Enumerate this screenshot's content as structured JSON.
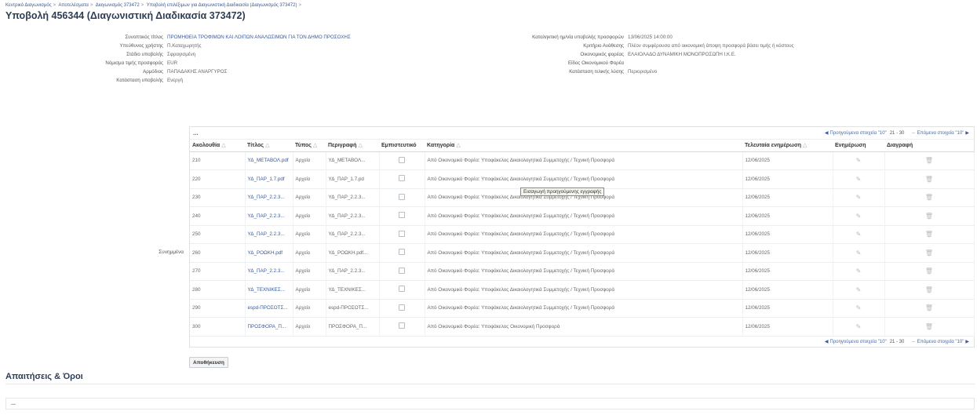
{
  "breadcrumb": [
    "Κεντρικό Διαγωνισμός",
    "Αποτελέσματα",
    "Διαγωνισμός 373472",
    "Υποβολή επιλέξιμων για Διαγωνιστική Διαδικασία (Διαγωνισμός 373472)"
  ],
  "page_title": "Υποβολή 456344 (Διαγωνιστική Διαδικασία 373472)",
  "left_fields": [
    {
      "label": "Συνοπτικός τίτλος",
      "value": "ΠΡΟΜΗΘΕΙΑ ΤΡΟΦΙΜΩΝ ΚΑΙ ΛΟΙΠΩΝ ΑΝΑΛΩΣΙΜΩΝ ΓΙΑ ΤΟΝ ΔΗΜΟ ΠΡΟΣΟΧΗΣ",
      "link": true
    },
    {
      "label": "Υπεύθυνος χρήστης",
      "value": "Π.Καταχωρητής",
      "link": false
    },
    {
      "label": "Στάδιο υποβολής",
      "value": "Σφραγισμένη",
      "link": false
    },
    {
      "label": "Νόμισμα τιμής προσφοράς",
      "value": "EUR",
      "link": false
    },
    {
      "label": "Αρμόδιος",
      "value": "ΠΑΠΑΔΑΚΗΣ ΑΝΑΡΓΥΡΟΣ",
      "link": false
    },
    {
      "label": "Κατάσταση υποβολής",
      "value": "Ενεργή",
      "link": false
    }
  ],
  "right_fields": [
    {
      "label": "Καταληκτική ημ/νία υποβολής προσφορών",
      "value": "13/06/2025 14:00:00"
    },
    {
      "label": "Κριτήριο Ανάθεσης",
      "value": "Πλέον συμφέρουσα από οικονομική άποψη προσφορά βάσει τιμής ή κόστους"
    },
    {
      "label": "Οικονομικός φορέας",
      "value": "ΕΛΑΙΟΛΑΔΟ ΔΥΝΑΜΙΚΗ ΜΟΝΟΠΡΟΣΩΠΗ Ι.Κ.Ε."
    },
    {
      "label": "Είδος Οικονομικού Φορέα",
      "value": ""
    },
    {
      "label": "Κατάσταση τελικής λύσης",
      "value": "Περιορισμένο"
    }
  ],
  "attachments_label": "Συνημμένα",
  "table": {
    "dots": "...",
    "pager": {
      "prev": "Προηγούμενα στοιχεία \"10\"",
      "range": "21 - 30",
      "next": "Επόμενα στοιχεία \"10\""
    },
    "columns": [
      "Ακολουθία",
      "Τίτλος",
      "Τύπος",
      "Περιγραφή",
      "Εμπιστευτικό",
      "Κατηγορία",
      "Τελευταία ενημέρωση",
      "Ενημέρωση",
      "Διαγραφή"
    ],
    "rows": [
      {
        "seq": "210",
        "title": "ΥΔ_ΜΕΤΑΒΟΛ.pdf",
        "type": "Αρχείο",
        "desc": "ΥΔ_ΜΕΤΑΒΟΛ...",
        "cat": "Από Οικονομικό Φορέα: Υποφάκελος Δικαιολογητικά Συμμετοχής / Τεχνική Προσφορά",
        "date": "12/06/2025"
      },
      {
        "seq": "220",
        "title": "ΥΔ_ΠΑΡ_1.7.pdf",
        "type": "Αρχείο",
        "desc": "ΥΔ_ΠΑΡ_1.7.pd",
        "cat": "Από Οικονομικό Φορέα: Υποφάκελος Δικαιολογητικά Συμμετοχής / Τεχνική Προσφορά",
        "date": "12/06/2025"
      },
      {
        "seq": "230",
        "title": "ΥΔ_ΠΑΡ_2.2.3...",
        "type": "Αρχείο",
        "desc": "ΥΔ_ΠΑΡ_2.2.3...",
        "cat": "Από Οικονομικό Φορέα: Υποφάκελος Δικαιολογητικά Συμμετοχής / Τεχνική Προσφορά",
        "date": "12/06/2025"
      },
      {
        "seq": "240",
        "title": "ΥΔ_ΠΑΡ_2.2.3...",
        "type": "Αρχείο",
        "desc": "ΥΔ_ΠΑΡ_2.2.3...",
        "cat": "Από Οικονομικό Φορέα: Υποφάκελος Δικαιολογητικά Συμμετοχής / Τεχνική Προσφορά",
        "date": "12/06/2025"
      },
      {
        "seq": "250",
        "title": "ΥΔ_ΠΑΡ_2.2.3...",
        "type": "Αρχείο",
        "desc": "ΥΔ_ΠΑΡ_2.2.3...",
        "cat": "Από Οικονομικό Φορέα: Υποφάκελος Δικαιολογητικά Συμμετοχής / Τεχνική Προσφορά",
        "date": "12/06/2025"
      },
      {
        "seq": "260",
        "title": "ΥΔ_ΡΟΩΚΗ.pdf",
        "type": "Αρχείο",
        "desc": "ΥΔ_ΡΟΩΚΗ.pdf...",
        "cat": "Από Οικονομικό Φορέα: Υποφάκελος Δικαιολογητικά Συμμετοχής / Τεχνική Προσφορά",
        "date": "12/06/2025"
      },
      {
        "seq": "270",
        "title": "ΥΔ_ΠΑΡ_2.2.3...",
        "type": "Αρχείο",
        "desc": "ΥΔ_ΠΑΡ_2.2.3...",
        "cat": "Από Οικονομικό Φορέα: Υποφάκελος Δικαιολογητικά Συμμετοχής / Τεχνική Προσφορά",
        "date": "12/06/2025"
      },
      {
        "seq": "280",
        "title": "ΥΔ_ΤΕΧΝΙΚΕΣ...",
        "type": "Αρχείο",
        "desc": "ΥΔ_ΤΕΧΝΙΚΕΣ...",
        "cat": "Από Οικονομικό Φορέα: Υποφάκελος Δικαιολογητικά Συμμετοχής / Τεχνική Προσφορά",
        "date": "12/06/2025"
      },
      {
        "seq": "290",
        "title": "espd-ΠΡΟΣΟΤΣ...",
        "type": "Αρχείο",
        "desc": "espd-ΠΡΟΣΟΤΣ...",
        "cat": "Από Οικονομικό Φορέα: Υποφάκελος Δικαιολογητικά Συμμετοχής / Τεχνική Προσφορά",
        "date": "12/06/2025"
      },
      {
        "seq": "300",
        "title": "ΠΡΟΣΦΟΡΑ_Π...",
        "type": "Αρχείο",
        "desc": "ΠΡΟΣΦΟΡΑ_Π...",
        "cat": "Από Οικονομικό Φορέα: Υποφάκελος Οικονομική Προσφορά",
        "date": "12/06/2025"
      }
    ]
  },
  "tooltip": "Εισαγωγή προηγούμενης εγγραφής",
  "update_button": "Αποθήκευση",
  "section_title": "Απαιτήσεις & Όροι",
  "section_dots": "...",
  "icons": {
    "edit": "pencil-icon",
    "delete": "trash-icon",
    "checkbox": "checkbox-icon"
  },
  "colors": {
    "link": "#3a5a9a",
    "title": "#2d3d55"
  }
}
